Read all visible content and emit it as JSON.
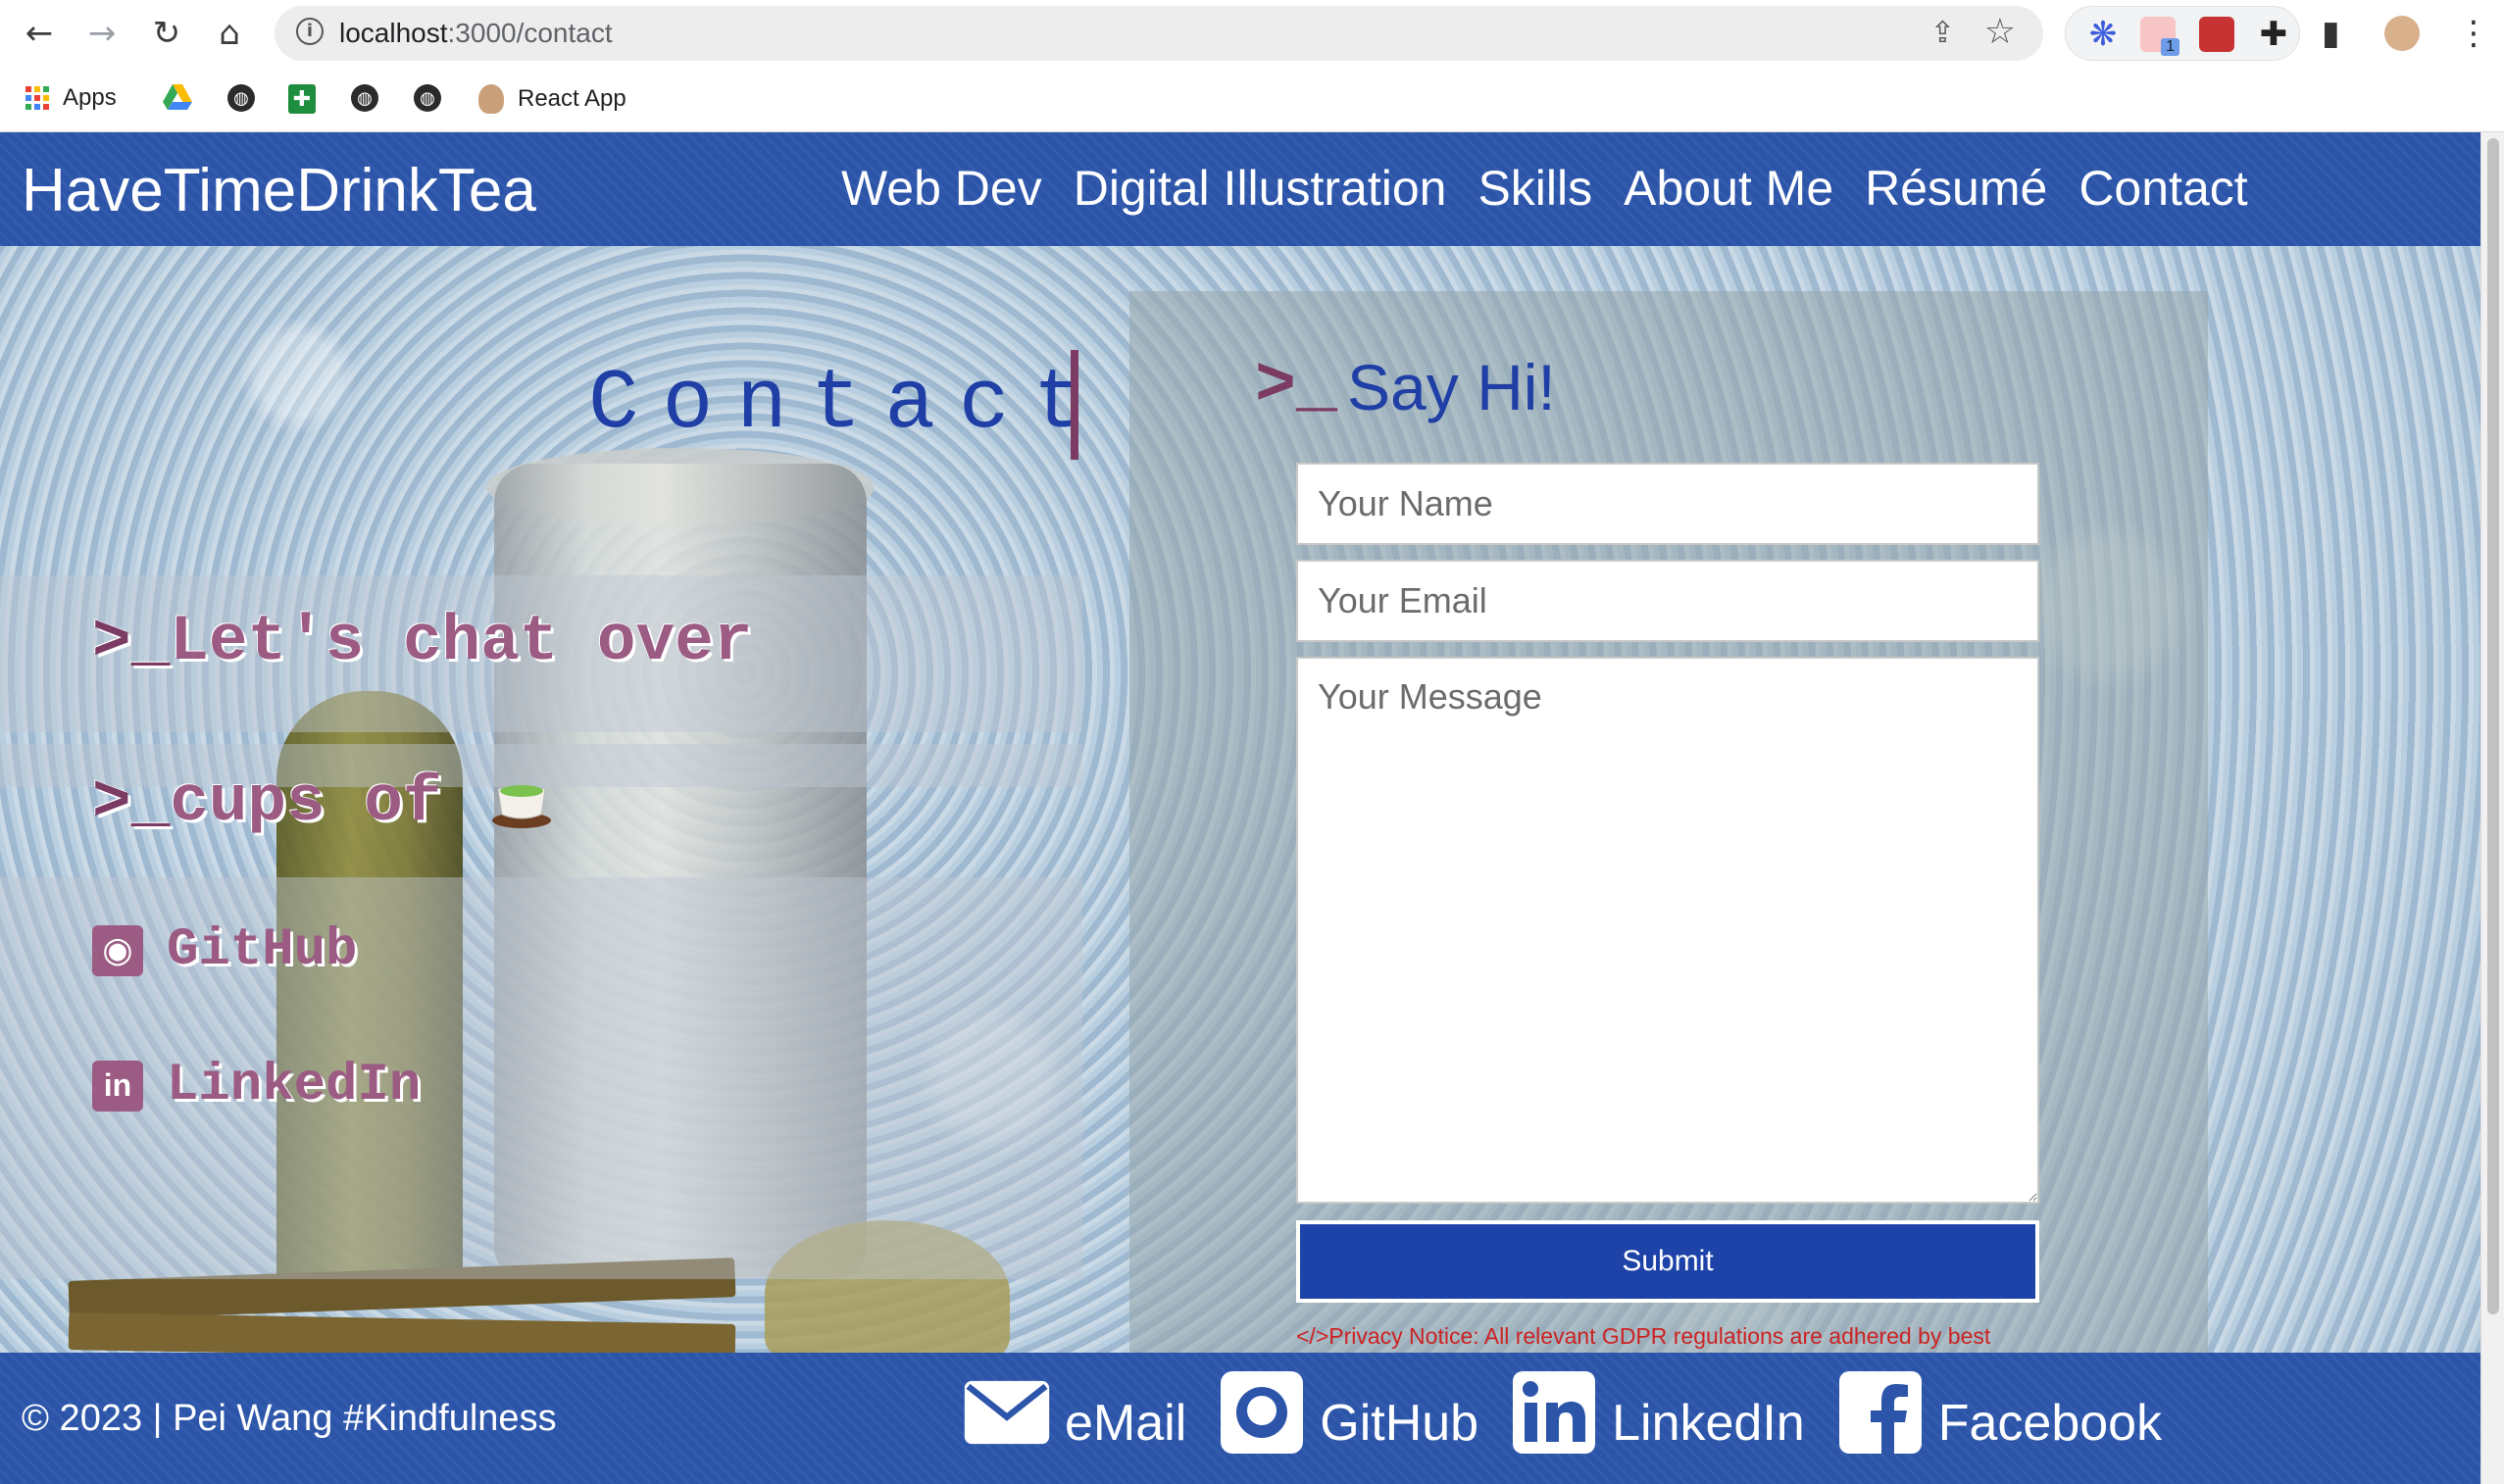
{
  "browser": {
    "url_host": "localhost",
    "url_path": ":3000/contact",
    "bookmarks": [
      {
        "label": "Apps",
        "icon": "apps-grid-icon"
      },
      {
        "label": "",
        "icon": "google-drive-icon"
      },
      {
        "label": "",
        "icon": "globe-icon"
      },
      {
        "label": "",
        "icon": "google-sheets-icon"
      },
      {
        "label": "",
        "icon": "globe-icon"
      },
      {
        "label": "",
        "icon": "globe-icon"
      },
      {
        "label": "React App",
        "icon": "avatar-icon"
      }
    ],
    "extension_badge": "1"
  },
  "site": {
    "brand": "HaveTimeDrinkTea",
    "nav": [
      "Web Dev",
      "Digital Illustration",
      "Skills",
      "About Me",
      "Résumé",
      "Contact"
    ],
    "accent": "#2c55aa",
    "accent_dark": "#1d43a8",
    "plum": "#9b5b83"
  },
  "left": {
    "title": "Contact",
    "prompt": ">_",
    "line1": "Let's chat over",
    "line2": "cups of",
    "github": "GitHub",
    "linkedin": "LinkedIn"
  },
  "form": {
    "heading": "Say Hi!",
    "name_placeholder": "Your Name",
    "email_placeholder": "Your Email",
    "message_placeholder": "Your Message",
    "submit": "Submit",
    "privacy_prefix": "</>",
    "privacy": "Privacy Notice: All relevant GDPR regulations are adhered by best endeavors.",
    "privacy_suffix": "</>"
  },
  "footer": {
    "copyright": "© 2023 | Pei Wang #Kindfulness",
    "links": [
      "eMail",
      "GitHub",
      "LinkedIn",
      "Facebook"
    ]
  }
}
